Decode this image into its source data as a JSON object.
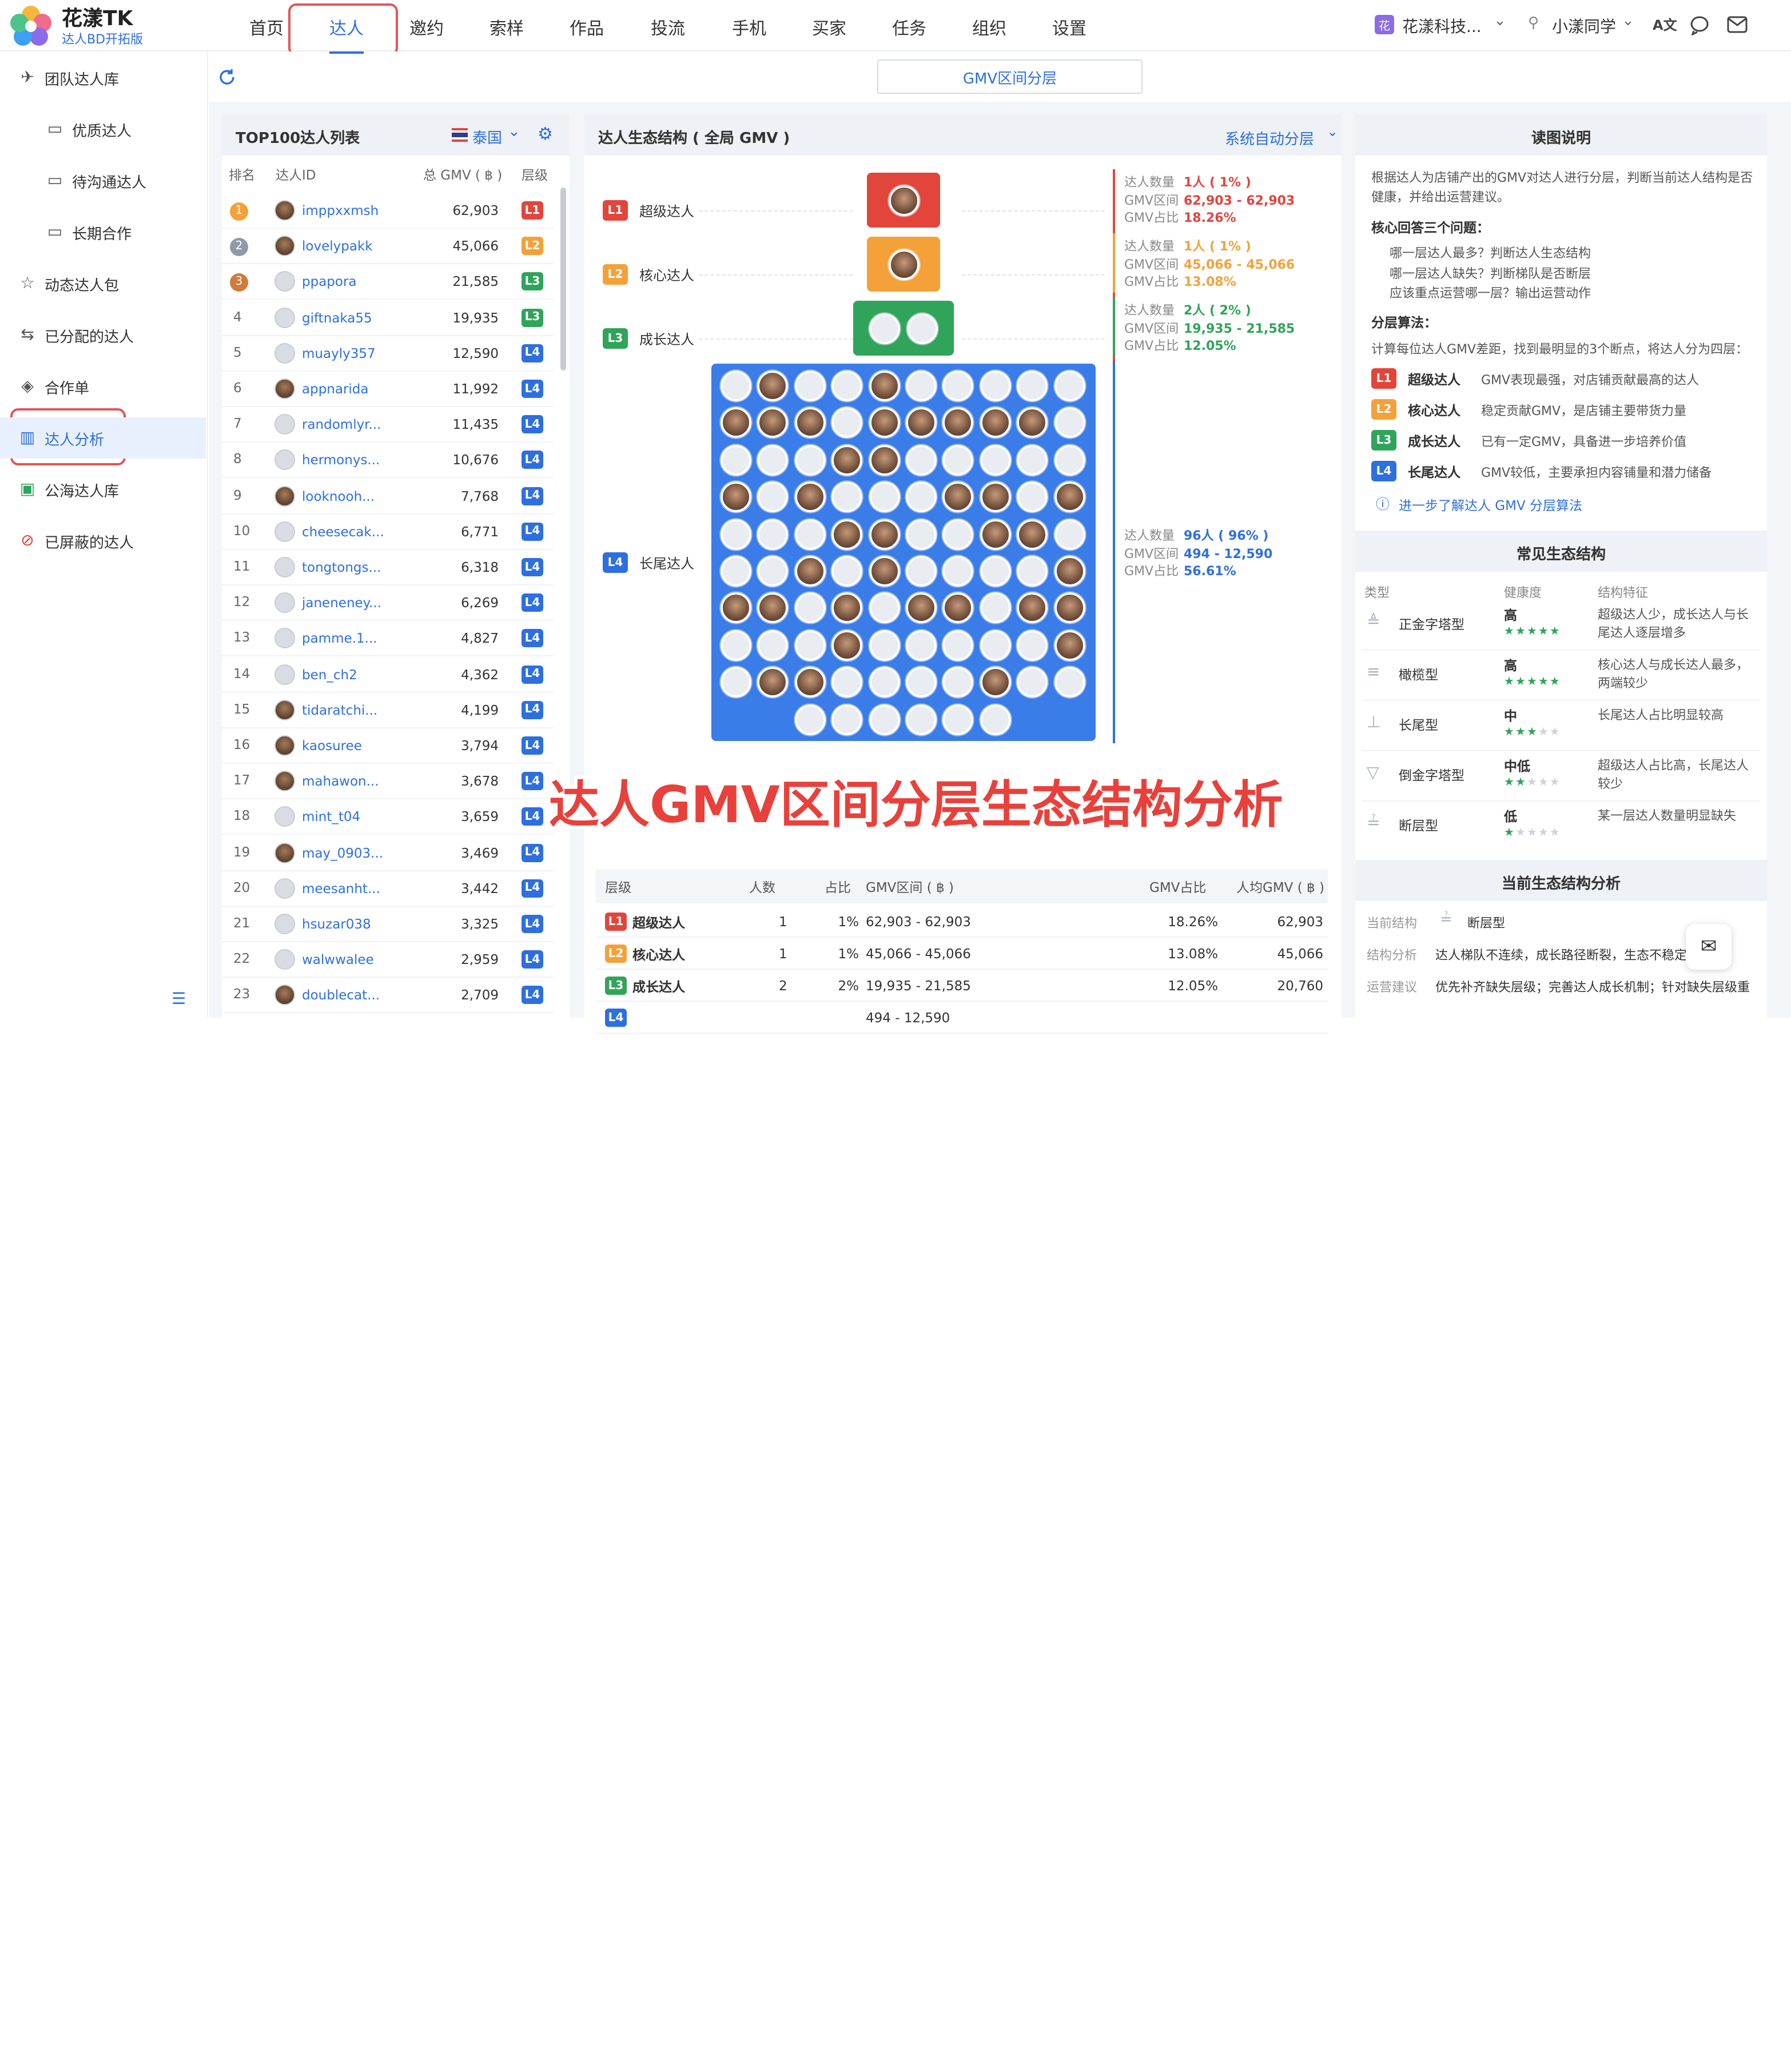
{
  "brand": {
    "title": "花漾TK",
    "subtitle": "达人BD开拓版"
  },
  "nav": [
    "首页",
    "达人",
    "邀约",
    "索样",
    "作品",
    "投流",
    "手机",
    "买家",
    "任务",
    "组织",
    "设置"
  ],
  "nav_active": "达人",
  "header_right": {
    "org": "花漾科技...",
    "user": "小漾同学",
    "org_badge": "花"
  },
  "sidebar": [
    {
      "label": "团队达人库",
      "icon": "team-icon",
      "indent": false
    },
    {
      "label": "优质达人",
      "icon": "folder-icon",
      "indent": true
    },
    {
      "label": "待沟通达人",
      "icon": "folder-icon",
      "indent": true
    },
    {
      "label": "长期合作",
      "icon": "folder-icon",
      "indent": true
    },
    {
      "label": "动态达人包",
      "icon": "star-icon",
      "indent": false
    },
    {
      "label": "已分配的达人",
      "icon": "assign-icon",
      "indent": false
    },
    {
      "label": "合作单",
      "icon": "handshake-icon",
      "indent": false
    },
    {
      "label": "达人分析",
      "icon": "chart-icon",
      "indent": false
    },
    {
      "label": "公海达人库",
      "icon": "public-icon",
      "indent": false
    },
    {
      "label": "已屏蔽的达人",
      "icon": "block-icon",
      "indent": false
    }
  ],
  "sidebar_active": "达人分析",
  "toolbar": {
    "tab": "GMV区间分层"
  },
  "top100": {
    "title": "TOP100达人列表",
    "region": "泰国",
    "columns": [
      "排名",
      "达人ID",
      "总 GMV ( ฿ )",
      "层级"
    ],
    "rows": [
      {
        "rank": "1",
        "id": "imppxxmsh",
        "gmv": "62,903",
        "level": "L1"
      },
      {
        "rank": "2",
        "id": "lovelypakk",
        "gmv": "45,066",
        "level": "L2"
      },
      {
        "rank": "3",
        "id": "ppapora",
        "gmv": "21,585",
        "level": "L3"
      },
      {
        "rank": "4",
        "id": "giftnaka55",
        "gmv": "19,935",
        "level": "L3"
      },
      {
        "rank": "5",
        "id": "muayly357",
        "gmv": "12,590",
        "level": "L4"
      },
      {
        "rank": "6",
        "id": "appnarida",
        "gmv": "11,992",
        "level": "L4"
      },
      {
        "rank": "7",
        "id": "randomlyr...",
        "gmv": "11,435",
        "level": "L4"
      },
      {
        "rank": "8",
        "id": "hermonys...",
        "gmv": "10,676",
        "level": "L4"
      },
      {
        "rank": "9",
        "id": "looknooh...",
        "gmv": "7,768",
        "level": "L4"
      },
      {
        "rank": "10",
        "id": "cheesecak...",
        "gmv": "6,771",
        "level": "L4"
      },
      {
        "rank": "11",
        "id": "tongtongs...",
        "gmv": "6,318",
        "level": "L4"
      },
      {
        "rank": "12",
        "id": "janeneney...",
        "gmv": "6,269",
        "level": "L4"
      },
      {
        "rank": "13",
        "id": "pamme.1...",
        "gmv": "4,827",
        "level": "L4"
      },
      {
        "rank": "14",
        "id": "ben_ch2",
        "gmv": "4,362",
        "level": "L4"
      },
      {
        "rank": "15",
        "id": "tidaratchi...",
        "gmv": "4,199",
        "level": "L4"
      },
      {
        "rank": "16",
        "id": "kaosuree",
        "gmv": "3,794",
        "level": "L4"
      },
      {
        "rank": "17",
        "id": "mahawon...",
        "gmv": "3,678",
        "level": "L4"
      },
      {
        "rank": "18",
        "id": "mint_t04",
        "gmv": "3,659",
        "level": "L4"
      },
      {
        "rank": "19",
        "id": "may_0903...",
        "gmv": "3,469",
        "level": "L4"
      },
      {
        "rank": "20",
        "id": "meesanht...",
        "gmv": "3,442",
        "level": "L4"
      },
      {
        "rank": "21",
        "id": "hsuzar038",
        "gmv": "3,325",
        "level": "L4"
      },
      {
        "rank": "22",
        "id": "walwwalee",
        "gmv": "2,959",
        "level": "L4"
      },
      {
        "rank": "23",
        "id": "doublecat...",
        "gmv": "2,709",
        "level": "L4"
      }
    ]
  },
  "ecology": {
    "title": "达人生态结构 ( 全局 GMV )",
    "mode": "系统自动分层",
    "labels": {
      "count": "达人数量",
      "range": "GMV区间",
      "share": "GMV占比"
    },
    "levels": [
      {
        "code": "L1",
        "name": "超级达人",
        "count": "1人 ( 1% )",
        "range": "62,903 - 62,903",
        "share": "18.26%"
      },
      {
        "code": "L2",
        "name": "核心达人",
        "count": "1人 ( 1% )",
        "range": "45,066 - 45,066",
        "share": "13.08%"
      },
      {
        "code": "L3",
        "name": "成长达人",
        "count": "2人 ( 2% )",
        "range": "19,935 - 21,585",
        "share": "12.05%"
      },
      {
        "code": "L4",
        "name": "长尾达人",
        "count": "96人 ( 96% )",
        "range": "494 - 12,590",
        "share": "56.61%"
      }
    ]
  },
  "overlay_title": "达人GMV区间分层生态结构分析",
  "summary_table": {
    "columns": [
      "层级",
      "人数",
      "占比",
      "GMV区间 ( ฿ )",
      "GMV占比",
      "人均GMV ( ฿ )"
    ],
    "rows": [
      {
        "code": "L1",
        "name": "超级达人",
        "count": "1",
        "pct": "1%",
        "range": "62,903 - 62,903",
        "share": "18.26%",
        "avg": "62,903"
      },
      {
        "code": "L2",
        "name": "核心达人",
        "count": "1",
        "pct": "1%",
        "range": "45,066 - 45,066",
        "share": "13.08%",
        "avg": "45,066"
      },
      {
        "code": "L3",
        "name": "成长达人",
        "count": "2",
        "pct": "2%",
        "range": "19,935 - 21,585",
        "share": "12.05%",
        "avg": "20,760"
      },
      {
        "code": "L4",
        "name": "",
        "count": "",
        "pct": "",
        "range": "494 - 12,590",
        "share": "",
        "avg": ""
      }
    ]
  },
  "readme": {
    "title": "读图说明",
    "intro": "根据达人为店铺产出的GMV对达人进行分层，判断当前达人结构是否健康，并给出运营建议。",
    "q_title": "核心回答三个问题：",
    "questions": [
      "哪一层达人最多？判断达人生态结构",
      "哪一层达人缺失？判断梯队是否断层",
      "应该重点运营哪一层？输出运营动作"
    ],
    "algo_title": "分层算法：",
    "algo": "计算每位达人GMV差距，找到最明显的3个断点，将达人分为四层：",
    "levels": [
      {
        "code": "L1",
        "name": "超级达人",
        "desc": "GMV表现最强，对店铺贡献最高的达人"
      },
      {
        "code": "L2",
        "name": "核心达人",
        "desc": "稳定贡献GMV，是店铺主要带货力量"
      },
      {
        "code": "L3",
        "name": "成长达人",
        "desc": "已有一定GMV，具备进一步培养价值"
      },
      {
        "code": "L4",
        "name": "长尾达人",
        "desc": "GMV较低，主要承担内容铺量和潜力储备"
      }
    ],
    "link": "进一步了解达人 GMV 分层算法"
  },
  "common": {
    "title": "常见生态结构",
    "columns": [
      "类型",
      "健康度",
      "结构特征"
    ],
    "rows": [
      {
        "type": "正金字塔型",
        "health": "高",
        "stars": 5,
        "desc": "超级达人少，成长达人与长尾达人逐层增多"
      },
      {
        "type": "橄榄型",
        "health": "高",
        "stars": 5,
        "desc": "核心达人与成长达人最多，两端较少"
      },
      {
        "type": "长尾型",
        "health": "中",
        "stars": 3,
        "desc": "长尾达人占比明显较高"
      },
      {
        "type": "倒金字塔型",
        "health": "中低",
        "stars": 2,
        "desc": "超级达人占比高，长尾达人较少"
      },
      {
        "type": "断层型",
        "health": "低",
        "stars": 1,
        "desc": "某一层达人数量明显缺失"
      }
    ]
  },
  "current": {
    "title": "当前生态结构分析",
    "rows": [
      {
        "label": "当前结构",
        "value": "断层型"
      },
      {
        "label": "结构分析",
        "value": "达人梯队不连续，成长路径断裂，生态不稳定"
      },
      {
        "label": "运营建议",
        "value": "优先补齐缺失层级；完善达人成长机制；针对缺失层级重"
      }
    ]
  },
  "colors": {
    "primary": "#2e6fe0",
    "L1": "#e2453c",
    "L2": "#f4a13a",
    "L3": "#2fa45a",
    "L4": "#2e6fe0",
    "highlight": "#e25555"
  },
  "grid": {
    "photo_cells": [
      1,
      4,
      10,
      11,
      12,
      14,
      15,
      16,
      17,
      18,
      23,
      24,
      30,
      32,
      36,
      37,
      39,
      43,
      44,
      47,
      48,
      52,
      54,
      59,
      60,
      61,
      63,
      65,
      66,
      68,
      69,
      73,
      79,
      81,
      82,
      87
    ]
  }
}
